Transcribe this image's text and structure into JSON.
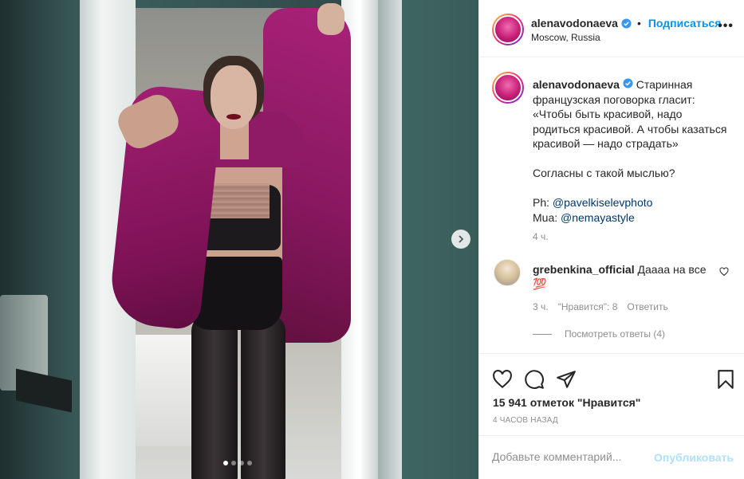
{
  "post": {
    "username": "alenavodonaeva",
    "follow_label": "Подписаться",
    "bullet": "•",
    "location": "Moscow, Russia",
    "more_label": "•••",
    "carousel": {
      "slide_count": 4,
      "active_index": 0
    }
  },
  "caption": {
    "username": "alenavodonaeva",
    "lines": [
      "Старинная французская поговорка гласит: «Чтобы быть красивой, надо родиться красивой. А чтобы казаться красивой — надо страдать»",
      "Согласны с такой мыслью?"
    ],
    "credit_ph_prefix": "Ph: ",
    "credit_ph_link": "@pavelkiselevphoto",
    "credit_mua_prefix": "Mua: ",
    "credit_mua_link": "@nemayastyle",
    "time": "4 ч."
  },
  "comment": {
    "username": "grebenkina_official",
    "text": "Даааа на все 💯",
    "time": "3 ч.",
    "likes": "\"Нравится\": 8",
    "reply_label": "Ответить",
    "view_replies": "Посмотреть ответы (4)"
  },
  "actions": {
    "icons": [
      "heart-icon",
      "comment-icon",
      "share-icon",
      "bookmark-icon"
    ]
  },
  "stats": {
    "likes_text": "15 941 отметок \"Нравится\"",
    "posted_ago": "4 ЧАСОВ НАЗАД"
  },
  "add_comment": {
    "placeholder": "Добавьте комментарий...",
    "publish_label": "Опубликовать"
  },
  "colors": {
    "accent": "#0095f6",
    "link": "#00376b",
    "muted": "#8e8e8e",
    "publish_disabled": "#b2dffc"
  }
}
